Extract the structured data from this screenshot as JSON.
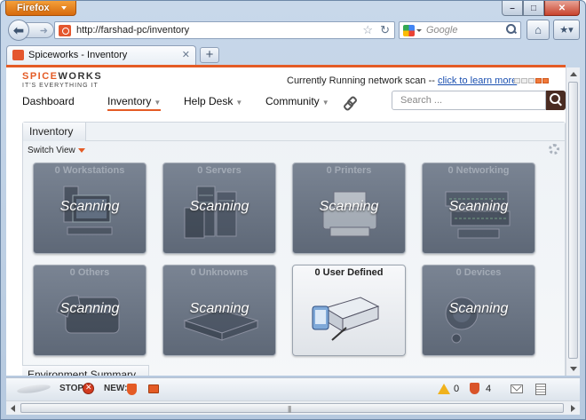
{
  "browser": {
    "app_button": "Firefox",
    "url": "http://farshad-pc/inventory",
    "search_placeholder": "Google",
    "tab_title": "Spiceworks - Inventory",
    "new_tab": "+"
  },
  "header": {
    "logo_main_a": "SPICE",
    "logo_main_b": "WORKS",
    "logo_tagline": "IT'S EVERYTHING IT",
    "scan_text": "Currently Running network scan -- ",
    "scan_link": "click to learn more",
    "search_placeholder": "Search ..."
  },
  "nav": [
    {
      "label": "Dashboard",
      "has_caret": false,
      "active": false
    },
    {
      "label": "Inventory",
      "has_caret": true,
      "active": true
    },
    {
      "label": "Help Desk",
      "has_caret": true,
      "active": false
    },
    {
      "label": "Community",
      "has_caret": true,
      "active": false
    }
  ],
  "inventory": {
    "tab_label": "Inventory",
    "switch_view": "Switch View",
    "cards": [
      {
        "label": "0 Workstations",
        "status": "Scanning",
        "icon": "workstation-icon"
      },
      {
        "label": "0 Servers",
        "status": "Scanning",
        "icon": "server-icon"
      },
      {
        "label": "0 Printers",
        "status": "Scanning",
        "icon": "printer-icon"
      },
      {
        "label": "0 Networking",
        "status": "Scanning",
        "icon": "network-switch-icon"
      },
      {
        "label": "0 Others",
        "status": "Scanning",
        "icon": "phone-icon"
      },
      {
        "label": "0 Unknowns",
        "status": "Scanning",
        "icon": "unknown-device-icon"
      },
      {
        "label": "0 User Defined",
        "status": "",
        "icon": "projector-icon"
      },
      {
        "label": "0 Devices",
        "status": "Scanning",
        "icon": "devices-icon"
      }
    ]
  },
  "environment": {
    "tab_label": "Environment Summary"
  },
  "statusbar": {
    "stop_label": "STOP",
    "new_label": "NEW:",
    "warnings_count": "0",
    "security_count": "4"
  },
  "colors": {
    "accent": "#e45b25",
    "card_bg": "#6b7584",
    "link": "#1a4fb0"
  }
}
